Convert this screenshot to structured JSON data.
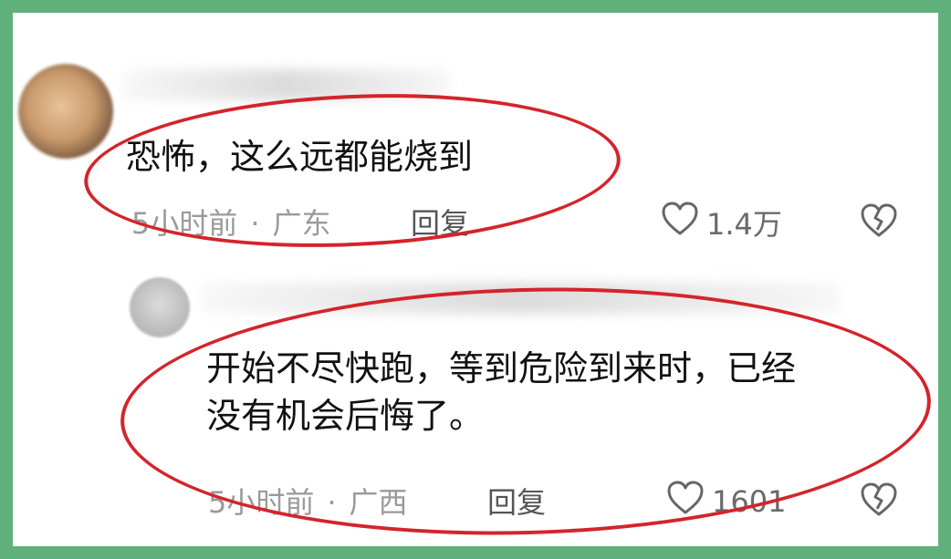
{
  "comments": [
    {
      "text": "恐怖，这么远都能烧到",
      "time": "5小时前",
      "separator": "·",
      "location": "广东",
      "reply_label": "回复",
      "likes": "1.4万"
    },
    {
      "text_line1": "开始不尽快跑，等到危险到来时，已经",
      "text_line2": "没有机会后悔了。",
      "time": "5小时前",
      "separator": "·",
      "location": "广西",
      "reply_label": "回复",
      "likes": "1601"
    }
  ],
  "colors": {
    "frame": "#5fb07a",
    "annotation": "#d4242b",
    "meta": "#9a9a9a"
  },
  "icons": [
    "heart-icon",
    "heart-broken-icon"
  ]
}
